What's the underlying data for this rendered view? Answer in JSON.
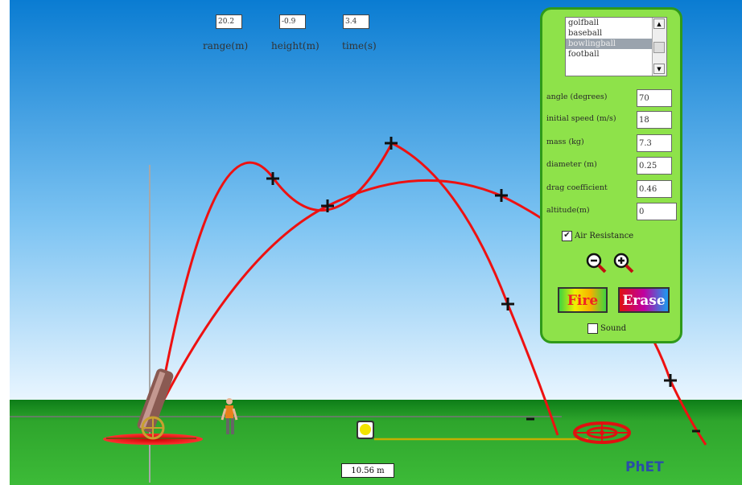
{
  "readouts": {
    "range": {
      "value": "20.2",
      "label": "range(m)"
    },
    "height": {
      "value": "-0.9",
      "label": "height(m)"
    },
    "time": {
      "value": "3.4",
      "label": "time(s)"
    }
  },
  "panel": {
    "projectiles": [
      "golfball",
      "baseball",
      "bowlingball",
      "football"
    ],
    "selected_projectile": "bowlingball",
    "params": {
      "angle": {
        "label": "angle (degrees)",
        "value": "70"
      },
      "speed": {
        "label": "initial speed (m/s)",
        "value": "18"
      },
      "mass": {
        "label": "mass (kg)",
        "value": "7.3"
      },
      "diameter": {
        "label": "diameter (m)",
        "value": "0.25"
      },
      "drag": {
        "label": "drag coefficient",
        "value": "0.46"
      },
      "altitude": {
        "label": "altitude(m)",
        "value": "0"
      }
    },
    "air_resistance": {
      "label": "Air Resistance",
      "checked": true
    },
    "fire_label": "Fire",
    "erase_label": "Erase",
    "sound": {
      "label": "Sound",
      "checked": false
    }
  },
  "scene": {
    "distance_label": "10.56 m",
    "logo": "PhET"
  },
  "colors": {
    "sky_top": "#0a7cd2",
    "sky_bottom": "#eaf6ff",
    "grass": "#2aa22a",
    "trajectory": "#ee1111",
    "panel": "#8ee24a",
    "target": "#e01010"
  },
  "icons": [
    "zoom-out-icon",
    "zoom-in-icon",
    "cannon-icon",
    "person-icon",
    "target-icon",
    "sun-icon"
  ]
}
